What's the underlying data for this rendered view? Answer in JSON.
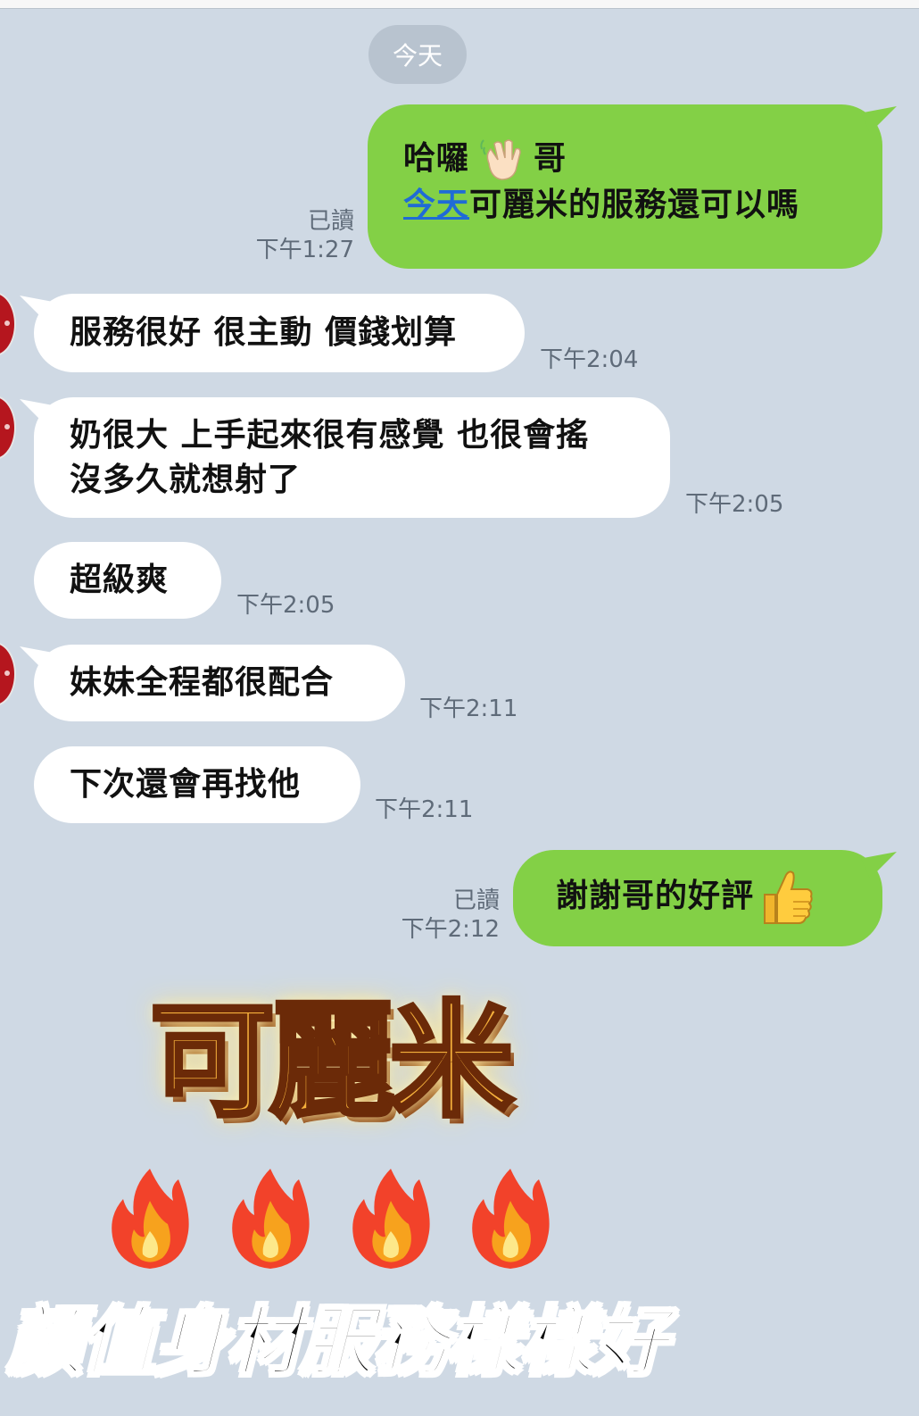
{
  "date_divider": "今天",
  "messages": [
    {
      "line1_prefix": "哈囉",
      "line1_suffix": "哥",
      "line2_link": "今天",
      "line2_rest": "可麗米的服務還可以嗎",
      "read": "已讀",
      "time": "下午1:27"
    },
    {
      "text": "服務很好 很主動 價錢划算",
      "time": "下午2:04"
    },
    {
      "line1": "奶很大 上手起來很有感覺 也很會搖",
      "line2": "沒多久就想射了",
      "time": "下午2:05"
    },
    {
      "text": "超級爽",
      "time": "下午2:05"
    },
    {
      "text": "妹妹全程都很配合",
      "time": "下午2:11"
    },
    {
      "text": "下次還會再找他",
      "time": "下午2:11"
    },
    {
      "text": "謝謝哥的好評",
      "read": "已讀",
      "time": "下午2:12"
    }
  ],
  "promo": {
    "brand": "可麗米",
    "slogan": "顏值身材服務樣樣好"
  },
  "icons": {
    "wave": "waving-hand-icon",
    "thumbs": "thumbs-up-icon",
    "flame": "fire-icon"
  },
  "colors": {
    "background": "#cfd9e4",
    "outgoing_bubble": "#83d046",
    "incoming_bubble": "#ffffff",
    "link": "#1f6bd6"
  }
}
